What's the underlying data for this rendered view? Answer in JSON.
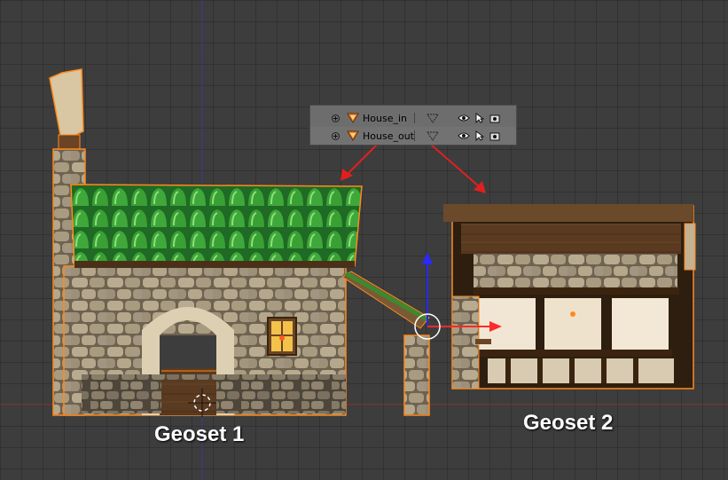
{
  "outliner": {
    "rows": [
      {
        "name": "House_in"
      },
      {
        "name": "House_out"
      }
    ]
  },
  "labels": {
    "geoset1": "Geoset 1",
    "geoset2": "Geoset 2"
  },
  "colors": {
    "selection_outline": "#ff8a1c",
    "annotation_arrow": "#e02020",
    "gizmo_z": "#2a2aff",
    "gizmo_x": "#ff2a2a",
    "grid_x_axis": "#8a3a3a",
    "grid_y_axis": "#3a3a8a"
  },
  "icons": [
    "expand-icon",
    "mesh-object-icon",
    "mesh-data-icon",
    "eye-icon",
    "cursor-select-icon",
    "camera-render-icon"
  ]
}
